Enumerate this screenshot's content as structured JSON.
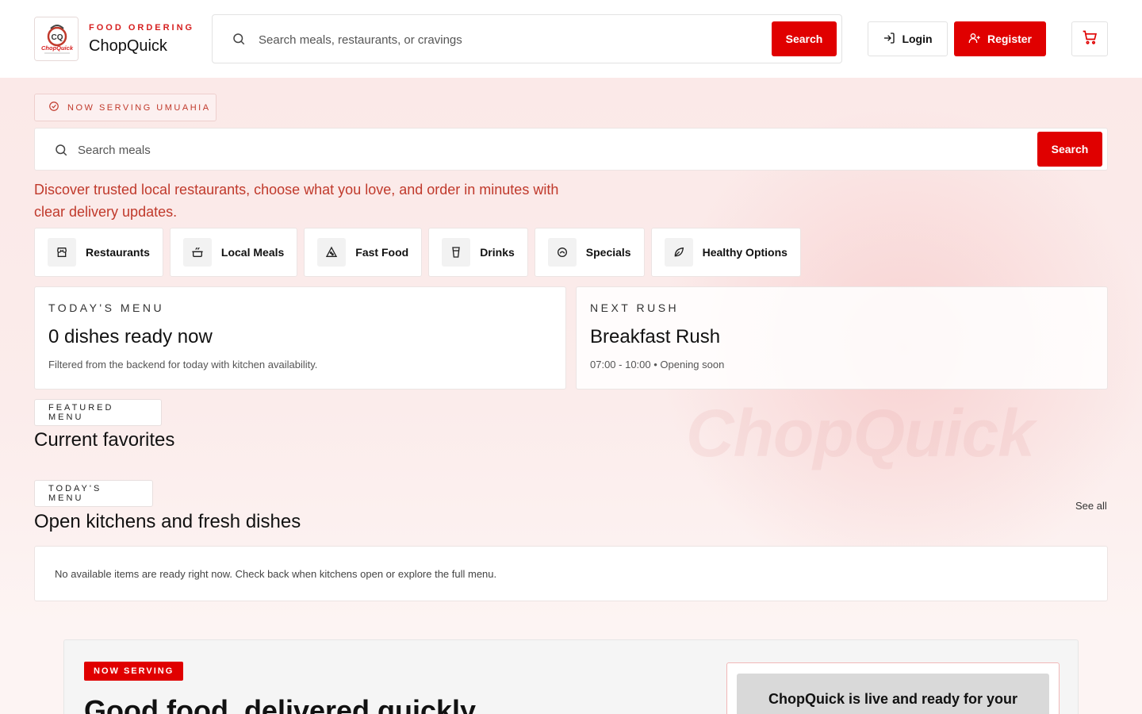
{
  "header": {
    "brand_kicker": "FOOD ORDERING",
    "brand_name": "ChopQuick",
    "logo_text": "ChopQuick",
    "search_placeholder": "Search meals, restaurants, or cravings",
    "search_button": "Search",
    "login_label": "Login",
    "register_label": "Register",
    "icons": {
      "search": "search-icon",
      "login": "login-icon",
      "register": "user-plus-icon",
      "cart": "cart-icon"
    }
  },
  "hero": {
    "serving_pill": "NOW SERVING UMUAHIA",
    "search_placeholder": "Search meals",
    "search_button": "Search",
    "tagline": "Discover trusted local restaurants, choose what you love, and order in minutes with clear delivery updates.",
    "watermark": "ChopQuick",
    "categories": [
      {
        "label": "Restaurants",
        "icon": "store-icon"
      },
      {
        "label": "Local Meals",
        "icon": "pot-icon"
      },
      {
        "label": "Fast Food",
        "icon": "pizza-icon"
      },
      {
        "label": "Drinks",
        "icon": "cup-icon"
      },
      {
        "label": "Specials",
        "icon": "dish-icon"
      },
      {
        "label": "Healthy Options",
        "icon": "leaf-icon"
      }
    ]
  },
  "cards": {
    "today": {
      "kicker": "TODAY'S MENU",
      "title": "0 dishes ready now",
      "subtitle": "Filtered from the backend for today with kitchen availability."
    },
    "next_rush": {
      "kicker": "NEXT RUSH",
      "title": "Breakfast Rush",
      "subtitle": "07:00 - 10:00 • Opening soon"
    }
  },
  "featured": {
    "tag": "FEATURED MENU",
    "title": "Current favorites"
  },
  "todays_menu": {
    "tag": "TODAY'S MENU",
    "title": "Open kitchens and fresh dishes",
    "see_all": "See all",
    "empty_message": "No available items are ready right now. Check back when kitchens open or explore the full menu."
  },
  "bottom": {
    "badge": "NOW SERVING",
    "title": "Good food, delivered quickly",
    "live_text": "ChopQuick is live and ready for your"
  },
  "colors": {
    "accent": "#e00000",
    "accent_text": "#c0392b",
    "hero_bg": "#fbe9e8"
  }
}
